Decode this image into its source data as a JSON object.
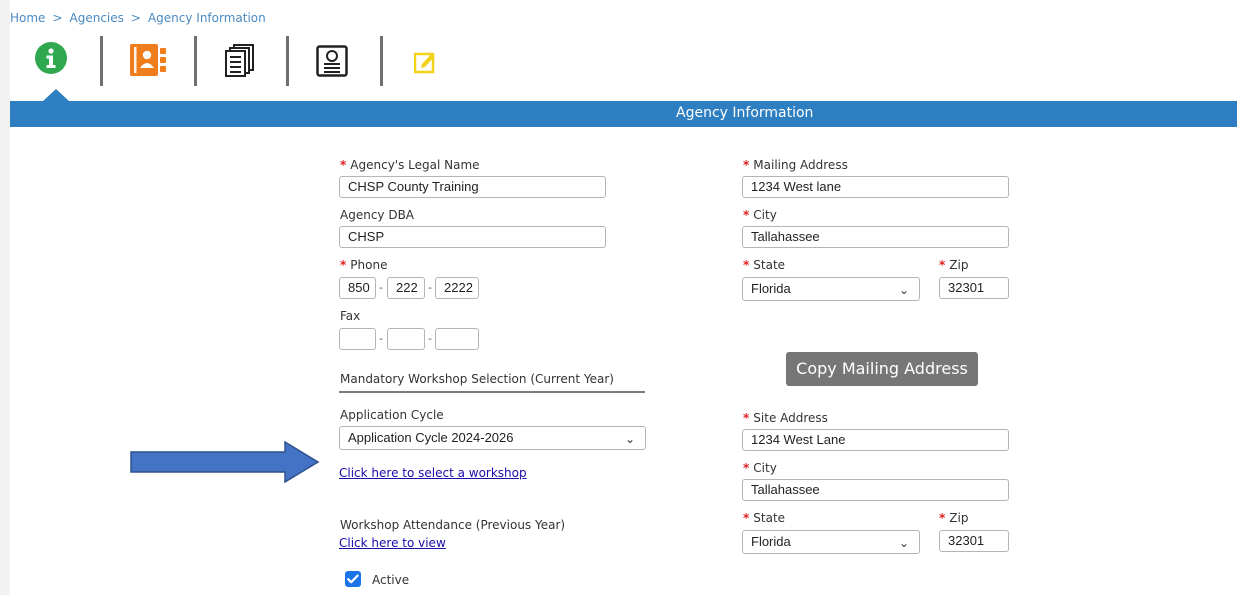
{
  "breadcrumb": {
    "home": "Home",
    "sep": ">",
    "agencies": "Agencies",
    "current": "Agency Information"
  },
  "toolbar": {
    "icons": [
      "info-icon",
      "contacts-icon",
      "documents-icon",
      "certificate-icon",
      "edit-icon"
    ],
    "colors": {
      "info": "#2fa84f",
      "contacts": "#f07d1b",
      "edit": "#f2d21b",
      "bar": "#2e7fc1"
    }
  },
  "section": {
    "title": "Agency Information"
  },
  "form": {
    "legal_name": {
      "label": "Agency's Legal Name",
      "value": "CHSP County Training"
    },
    "dba": {
      "label": "Agency DBA",
      "value": "CHSP"
    },
    "phone": {
      "label": "Phone",
      "area": "850",
      "prefix": "222",
      "line": "2222"
    },
    "fax": {
      "label": "Fax",
      "area": "",
      "prefix": "",
      "line": ""
    },
    "phone_sep": "-",
    "mandatory_heading": "Mandatory Workshop Selection (Current Year)",
    "app_cycle": {
      "label": "Application Cycle",
      "value": "Application Cycle 2024-2026"
    },
    "select_workshop_link": "Click here to select a workshop",
    "attendance_label": "Workshop Attendance (Previous Year)",
    "view_link": "Click here to view",
    "active_label": "Active",
    "mailing_address": {
      "label": "Mailing Address",
      "value": "1234 West lane"
    },
    "mailing_city": {
      "label": "City",
      "value": "Tallahassee"
    },
    "mailing_state": {
      "label": "State",
      "value": "Florida"
    },
    "mailing_zip": {
      "label": "Zip",
      "value": "32301"
    },
    "copy_button": "Copy Mailing Address",
    "site_address": {
      "label": "Site Address",
      "value": "1234 West Lane"
    },
    "site_city": {
      "label": "City",
      "value": "Tallahassee"
    },
    "site_state": {
      "label": "State",
      "value": "Florida"
    },
    "site_zip": {
      "label": "Zip",
      "value": "32301"
    },
    "required_mark": "*"
  }
}
